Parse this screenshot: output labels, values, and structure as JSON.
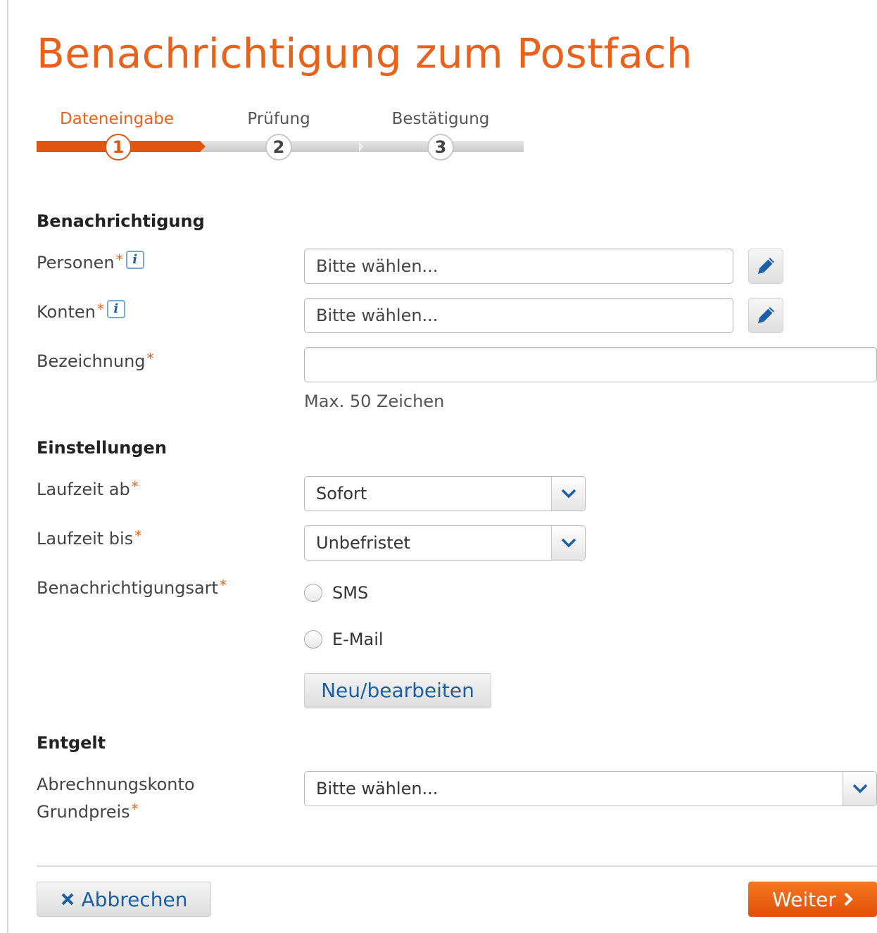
{
  "page": {
    "title": "Benachrichtigung zum Postfach"
  },
  "stepper": {
    "steps": [
      {
        "label": "Dateneingabe",
        "number": "1",
        "active": true
      },
      {
        "label": "Prüfung",
        "number": "2",
        "active": false
      },
      {
        "label": "Bestätigung",
        "number": "3",
        "active": false
      }
    ]
  },
  "sections": {
    "notification": {
      "heading": "Benachrichtigung",
      "persons": {
        "label": "Personen",
        "required": "*",
        "info": "i",
        "placeholder": "Bitte wählen...",
        "edit_icon": "pencil-icon"
      },
      "accounts": {
        "label": "Konten",
        "required": "*",
        "info": "i",
        "placeholder": "Bitte wählen...",
        "edit_icon": "pencil-icon"
      },
      "designation": {
        "label": "Bezeichnung",
        "required": "*",
        "value": "",
        "hint": "Max. 50 Zeichen"
      }
    },
    "settings": {
      "heading": "Einstellungen",
      "runtime_from": {
        "label": "Laufzeit ab",
        "required": "*",
        "value": "Sofort"
      },
      "runtime_to": {
        "label": "Laufzeit bis",
        "required": "*",
        "value": "Unbefristet"
      },
      "notification_type": {
        "label": "Benachrichtigungsart",
        "required": "*",
        "options": [
          {
            "label": "SMS",
            "checked": false
          },
          {
            "label": "E-Mail",
            "checked": false
          }
        ],
        "edit_button": "Neu/bearbeiten"
      }
    },
    "fee": {
      "heading": "Entgelt",
      "billing_account": {
        "label_line1": "Abrechnungskonto",
        "label_line2": "Grundpreis",
        "required": "*",
        "value": "Bitte wählen..."
      }
    }
  },
  "footer": {
    "cancel": {
      "label": "Abbrechen",
      "icon": "close-icon"
    },
    "next": {
      "label": "Weiter",
      "icon": "chevron-right-icon"
    }
  },
  "colors": {
    "accent": "#e8621c",
    "link": "#1a5fa8",
    "primary_button": "#e0500a"
  }
}
